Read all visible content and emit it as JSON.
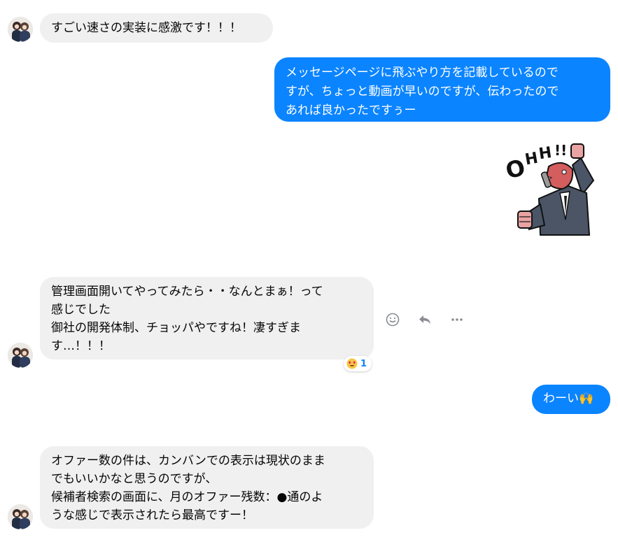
{
  "messages": [
    {
      "id": "m1",
      "direction": "incoming",
      "text": "すごい速さの実装に感激です！！！"
    },
    {
      "id": "m2",
      "direction": "outgoing",
      "text": "メッセージページに飛ぶやり方を記載しているので\nすが、ちょっと動画が早いのですが、伝わったので\nあれば良かったですぅー"
    },
    {
      "id": "m3",
      "direction": "outgoing",
      "type": "sticker",
      "sticker": "ohh-fist-pump-sticker",
      "sticker_text": "OHH!!"
    },
    {
      "id": "m4",
      "direction": "incoming",
      "text": "管理画面開いてやってみたら・・なんとまぁ！って\n感じでした\n御社の開発体制、チョッパやですね！凄すぎま\nす…！！！",
      "reaction": {
        "emoji": "heart-eyes-emoji",
        "count": "1"
      }
    },
    {
      "id": "m5",
      "direction": "outgoing",
      "text": "わーい🙌"
    },
    {
      "id": "m6",
      "direction": "incoming",
      "text": "オファー数の件は、カンバンでの表示は現状のまま\nでもいいかなと思うのですが、\n候補者検索の画面に、月のオファー残数：●通のよ\nうな感じで表示されたら最高ですー！"
    }
  ],
  "message_actions": {
    "react_icon": "smiley-icon",
    "reply_icon": "reply-icon",
    "more_icon": "more-icon"
  },
  "colors": {
    "outgoing_bubble": "#0b84ff",
    "incoming_bubble": "#f0f0f0",
    "reaction_count": "#0b84ff"
  }
}
